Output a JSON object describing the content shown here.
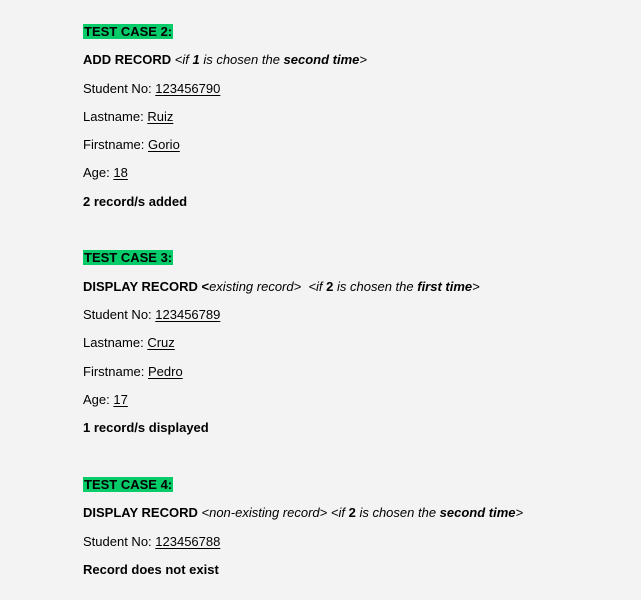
{
  "highlight_color": "#05cc68",
  "test_cases": [
    {
      "title": "TEST CASE 2:",
      "heading": {
        "action": "ADD RECORD",
        "lead": "<",
        "note_italic": "",
        "cond_pre": "<if ",
        "cond_num": "1",
        "cond_mid": " is chosen the ",
        "cond_when": "second time",
        "cond_post": ">"
      },
      "fields": [
        {
          "label": "Student No: ",
          "value": "123456790"
        },
        {
          "label": "Lastname: ",
          "value": "Ruiz"
        },
        {
          "label": "Firstname: ",
          "value": "Gorio"
        },
        {
          "label": "Age: ",
          "value": "18"
        }
      ],
      "result": "2 record/s added"
    },
    {
      "title": "TEST CASE 3:",
      "heading": {
        "action": "DISPLAY RECORD <",
        "note_italic": "existing record>",
        "cond_pre": "<if ",
        "cond_num": "2",
        "cond_mid": " is chosen the ",
        "cond_when": "first time",
        "cond_post": ">"
      },
      "fields": [
        {
          "label": "Student No: ",
          "value": "123456789"
        },
        {
          "label": "Lastname: ",
          "value": "Cruz"
        },
        {
          "label": "Firstname: ",
          "value": "Pedro"
        },
        {
          "label": "Age: ",
          "value": "17"
        }
      ],
      "result": "1 record/s displayed"
    },
    {
      "title": "TEST CASE 4:",
      "heading": {
        "action": "DISPLAY RECORD",
        "note_italic": "<non-existing record>",
        "cond_pre": "<if ",
        "cond_num": "2",
        "cond_mid": " is chosen the ",
        "cond_when": "second time",
        "cond_post": ">"
      },
      "fields": [
        {
          "label": "Student No: ",
          "value": "123456788"
        }
      ],
      "result": "Record does not exist"
    }
  ]
}
